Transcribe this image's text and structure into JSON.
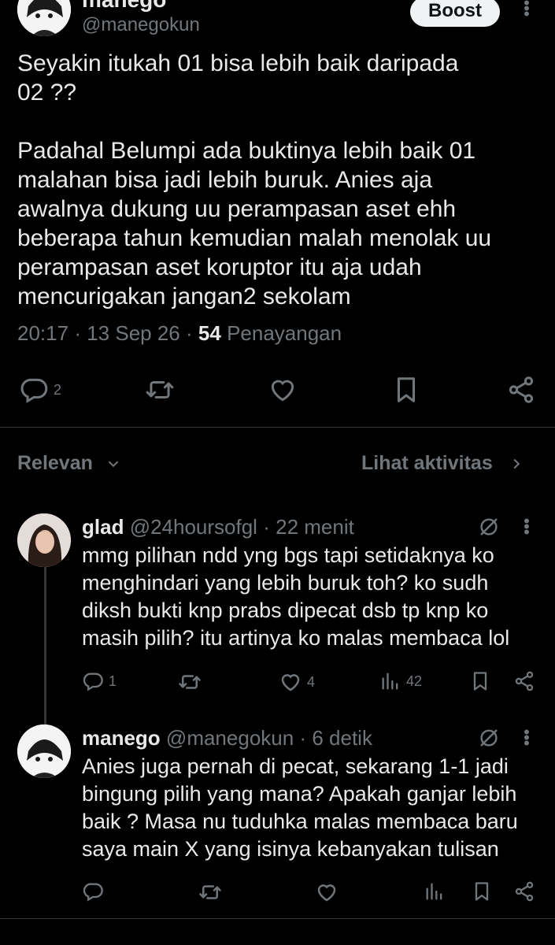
{
  "post": {
    "author_name": "manego",
    "author_handle": "@manegokun",
    "boost_label": "Boost",
    "body_lines_1": [
      "Seyakin itukah 01 bisa lebih baik daripada",
      "02 ??"
    ],
    "body_lines_2": [
      "Padahal Belumpi ada buktinya lebih baik 01",
      "malahan bisa jadi lebih buruk. Anies aja",
      "awalnya dukung uu perampasan aset ehh",
      "beberapa tahun kemudian malah menolak uu",
      "perampasan aset koruptor itu aja udah",
      "mencurigakan jangan2 sekolam"
    ],
    "time": "20:17",
    "date": "13 Sep 26",
    "views_count": "54",
    "views_label": "Penayangan",
    "reply_count": "2"
  },
  "sort": {
    "label": "Relevan",
    "activity_label": "Lihat aktivitas"
  },
  "replies": [
    {
      "name": "glad",
      "handle": "@24hoursofgl",
      "time": "22 menit",
      "lines": [
        "mmg pilihan ndd yng bgs tapi setidaknya ko",
        "menghindari yang lebih buruk toh? ko sudh",
        "diksh bukti knp prabs dipecat dsb tp knp ko",
        "masih pilih? itu artinya ko malas membaca lol"
      ],
      "reply_count": "1",
      "like_count": "4",
      "view_count": "42"
    },
    {
      "name": "manego",
      "handle": "@manegokun",
      "time": "6 detik",
      "lines": [
        "Anies juga pernah di pecat, sekarang 1-1 jadi",
        "bingung pilih yang mana? Apakah ganjar lebih",
        "baik ? Masa nu tuduhka malas membaca baru",
        "saya main X yang isinya kebanyakan tulisan"
      ]
    }
  ],
  "separator": "·",
  "icons": [
    "reply-icon",
    "retweet-icon",
    "like-icon",
    "bookmark-icon",
    "share-icon",
    "views-icon",
    "grok-icon",
    "chevron-down-icon",
    "chevron-right-icon",
    "more-icon"
  ],
  "colors": {
    "background": "#000000",
    "text": "#e7e9ea",
    "muted": "#71767b",
    "divider": "#2f3336",
    "boost_bg": "#eff3f4"
  }
}
